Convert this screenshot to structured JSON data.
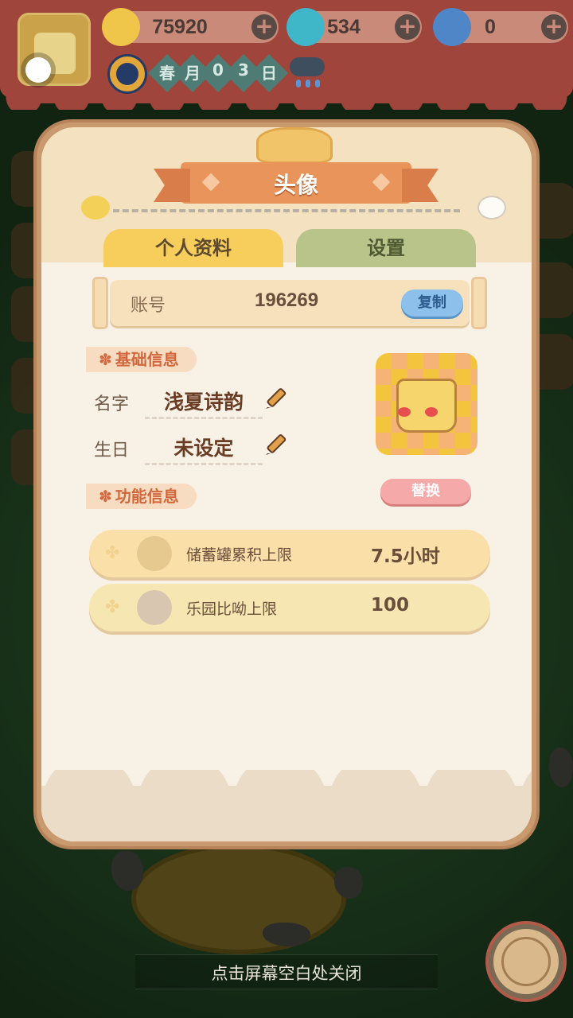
{
  "resources": {
    "banana": "75920",
    "flame": "534",
    "blue_banana": "0"
  },
  "date": [
    "春",
    "月",
    "0",
    "3",
    "日"
  ],
  "modal": {
    "title": "头像",
    "tabs": [
      "个人资料",
      "设置"
    ],
    "account": {
      "label": "账号",
      "id": "196269",
      "copy_label": "复制"
    },
    "basic_section": "基础信息",
    "name_label": "名字",
    "name_value": "浅夏诗韵",
    "birthday_label": "生日",
    "birthday_value": "未设定",
    "replace_label": "替换",
    "function_section": "功能信息",
    "rows": [
      {
        "label": "储蓄罐累积上限",
        "value": "7.5小时"
      },
      {
        "label": "乐园比呦上限",
        "value": "100"
      }
    ]
  },
  "close_hint": "点击屏幕空白处关闭",
  "colors": {
    "accent_ribbon": "#e8945a",
    "tab_active": "#f7cd5c",
    "tab_inactive": "#b9c48a",
    "copy_button": "#8ec0ec",
    "replace_button": "#f6a9a9"
  }
}
